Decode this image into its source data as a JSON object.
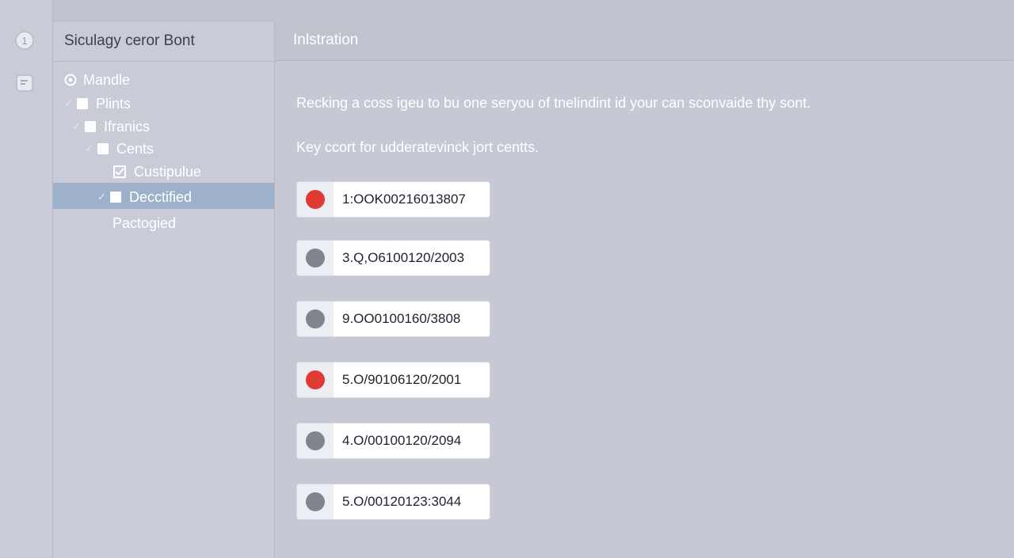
{
  "sidebar": {
    "title": "Siculagy ceror Bont",
    "items": [
      {
        "label": "Mandle"
      },
      {
        "label": "Plints"
      },
      {
        "label": "Ifranics"
      },
      {
        "label": "Cents"
      },
      {
        "label": "Custipulue"
      },
      {
        "label": "Decctified"
      },
      {
        "label": "Pactogied"
      }
    ]
  },
  "main": {
    "header_title": "Inlstration",
    "description": "Recking a coss igeu to bu one seryou of tnelindint id your can sconvaide thy sont.",
    "subheading": "Key ccort for udderatevinck jort centts."
  },
  "records": [
    {
      "code": "1:OOK00216013807",
      "status_color": "#e03a34"
    },
    {
      "code": "3.Q,O6100120/2003",
      "status_color": "#80848f"
    },
    {
      "code": "9.OO0100160/3808",
      "status_color": "#80848f"
    },
    {
      "code": "5.O/90106120/2001",
      "status_color": "#e03a34"
    },
    {
      "code": "4.O/00100120/2094",
      "status_color": "#80848f"
    },
    {
      "code": "5.O/00120123:3044",
      "status_color": "#80848f"
    }
  ],
  "colors": {
    "selected_row": "#9eb1ca",
    "status_red": "#e03a34",
    "status_gray": "#80848f"
  },
  "icons": {
    "rail_top": "info-icon",
    "rail_second": "document-icon",
    "tree_root": "gear-icon"
  }
}
